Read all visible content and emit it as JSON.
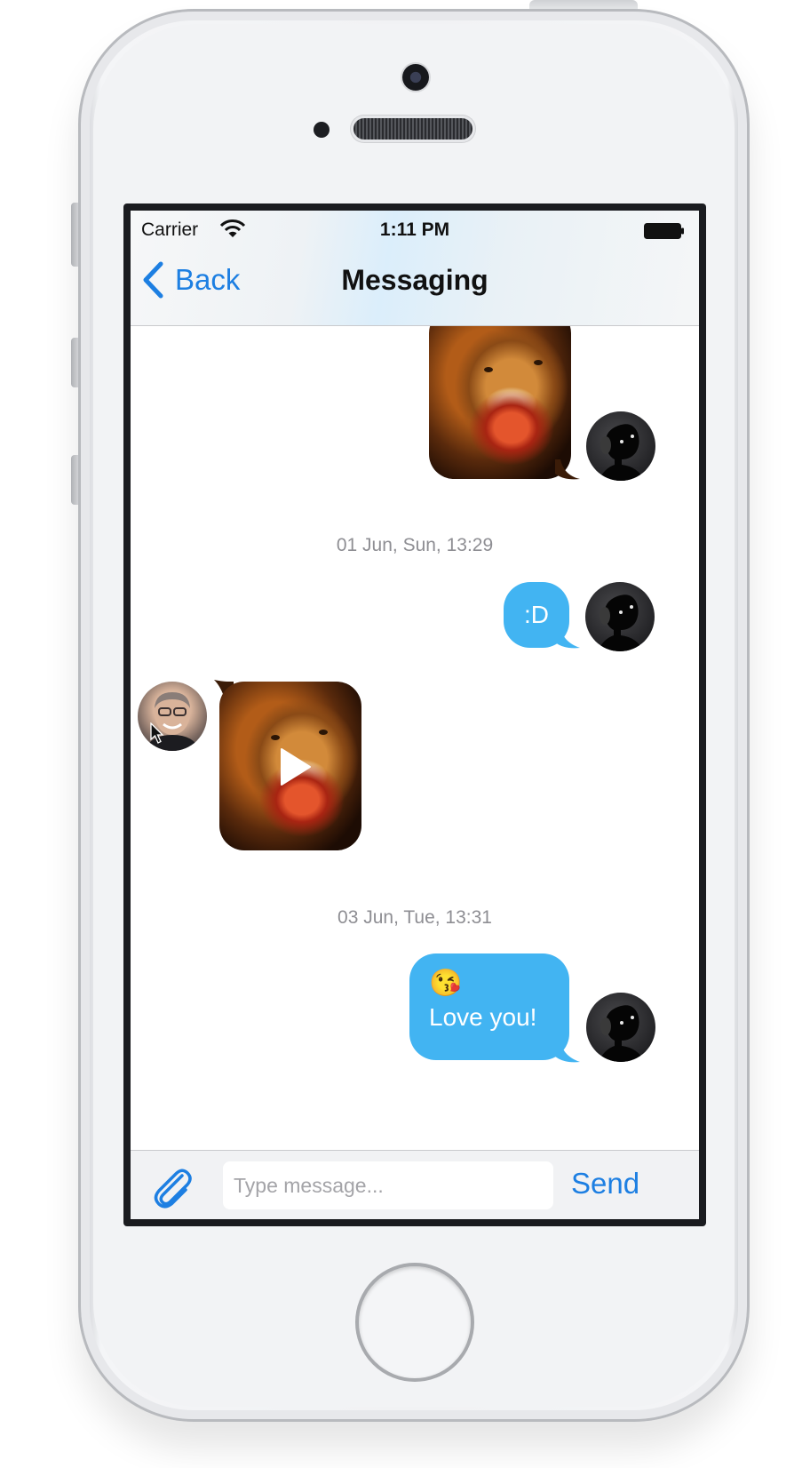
{
  "status_bar": {
    "carrier": "Carrier",
    "time": "1:11 PM"
  },
  "nav": {
    "back_label": "Back",
    "title": "Messaging"
  },
  "messages": [
    {
      "type": "image",
      "sender": "me"
    },
    {
      "type": "timestamp",
      "text": "01 Jun, Sun, 13:29"
    },
    {
      "type": "text",
      "sender": "me",
      "text": ":D"
    },
    {
      "type": "video",
      "sender": "contact"
    },
    {
      "type": "timestamp",
      "text": "03 Jun, Tue, 13:31"
    },
    {
      "type": "text",
      "sender": "me",
      "emoji": "😘",
      "text": "Love you!"
    }
  ],
  "input_bar": {
    "placeholder": "Type message...",
    "send_label": "Send"
  },
  "colors": {
    "accent": "#1d7fe2",
    "bubble": "#42b4f2",
    "timestamp": "#8e8e93"
  }
}
